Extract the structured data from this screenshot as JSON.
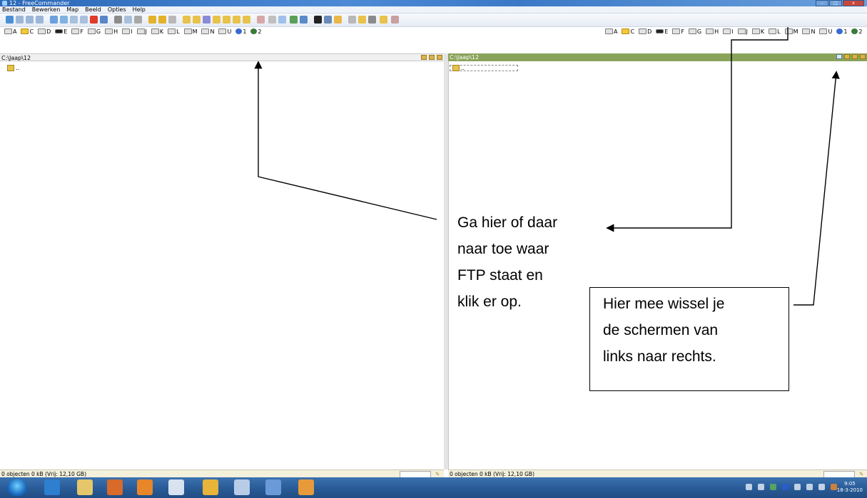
{
  "window": {
    "title": "12 - FreeCommander",
    "buttons": {
      "minimize": "–",
      "maximize": "□",
      "close": "x"
    }
  },
  "menu": [
    "Bestand",
    "Bewerken",
    "Map",
    "Beeld",
    "Opties",
    "Help"
  ],
  "drives": [
    "A",
    "C",
    "D",
    "E",
    "F",
    "G",
    "H",
    "I",
    "J",
    "K",
    "L",
    "M",
    "N",
    "U",
    "1",
    "2"
  ],
  "left_panel": {
    "path": "C:\\Jaap\\12",
    "up_item": "..",
    "status": "0 objecten  0 kB   (Vrij: 12,10 GB)"
  },
  "right_panel": {
    "path": "C:\\Jaap\\12",
    "up_item": "..",
    "status": "0 objecten  0 kB   (Vrij: 12,10 GB)"
  },
  "annotations": {
    "callout1": [
      "Ga hier of daar",
      "naar toe waar",
      "FTP staat en",
      "klik er op."
    ],
    "callout2": [
      "Hier mee wissel je",
      "de schermen van",
      "links naar rechts."
    ]
  },
  "taskbar": {
    "clock_time": "9:05",
    "clock_date": "18-3-2010"
  },
  "colors": {
    "titlebar": "#2a68b8",
    "active_path": "#8aa35a",
    "statusbar": "#f3f0dc",
    "taskbar": "#2a5c98"
  }
}
